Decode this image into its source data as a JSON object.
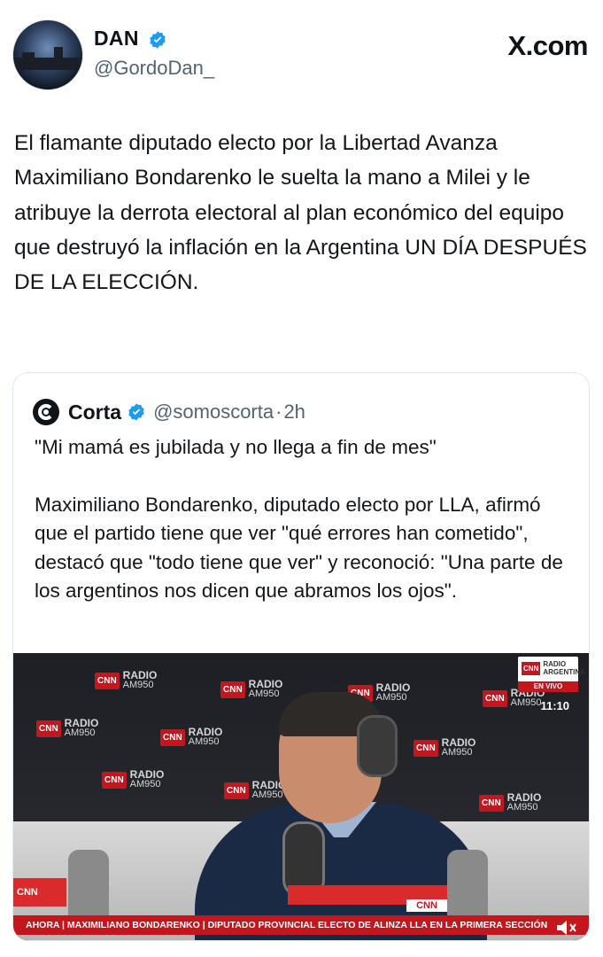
{
  "brand": {
    "site_label": "X.com",
    "accent": "#1d9bf0",
    "cnn_red": "#c4161c"
  },
  "author": {
    "name": "DAN",
    "handle": "@GordoDan_",
    "verified": true
  },
  "tweet": {
    "text": "El flamante diputado electo por la Libertad Avanza Maximiliano Bondarenko le suelta la mano a Milei y le atribuye la derrota electoral al plan económico del equipo que destruyó la inflación en la Argentina UN DÍA DESPUÉS DE LA ELECCIÓN."
  },
  "quote": {
    "name": "Corta",
    "handle": "@somoscorta",
    "separator": "·",
    "time": "2h",
    "paragraph1": "\"Mi mamá es jubilada y no llega a fin de mes\"",
    "paragraph2": "Maximiliano Bondarenko, diputado electo por LLA, afirmó que el partido tiene que ver \"qué errores han cometido\", destacó que \"todo tiene que ver\" y reconoció: \"Una parte de los argentinos nos dicen que abramos los ojos\"."
  },
  "video": {
    "backdrop_logo": "CNN",
    "backdrop_line1": "RADIO",
    "backdrop_line2": "AM950",
    "live_badge_logo": "CNN",
    "live_badge_line1": "RADIO",
    "live_badge_line2": "ARGENTINA",
    "live_label": "EN VIVO",
    "clock": "11:10",
    "lower_third": "AHORA | MAXIMILIANO BONDARENKO | DIPUTADO PROVINCIAL ELECTO DE ALINZA LLA EN LA PRIMERA SECCIÓN",
    "mic_brand": "CNN",
    "sound_icon": "mute-speaker-icon"
  }
}
